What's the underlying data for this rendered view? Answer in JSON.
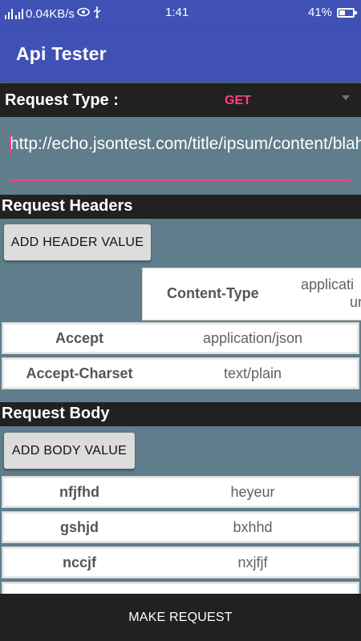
{
  "status_bar": {
    "network_speed": "0.04KB/s",
    "time": "1:41",
    "battery": "41%",
    "battery_level": 0.41,
    "icons": [
      "signal-icon",
      "sim-signal-icon",
      "eye-icon",
      "usb-icon",
      "battery-icon"
    ]
  },
  "app": {
    "title": "Api Tester",
    "accent_color": "#3f51b5",
    "highlight_color": "#ff4081"
  },
  "request_type": {
    "label": "Request Type :",
    "selected": "GET"
  },
  "url_input": {
    "value": "http://echo.jsontest.com/title/ipsum/content/blah"
  },
  "headers_section": {
    "title": "Request Headers",
    "add_button": "ADD HEADER VALUE",
    "rows": [
      {
        "key": "Content-Type",
        "value": "applicati",
        "value_line2": "ur"
      },
      {
        "key": "Accept",
        "value": "application/json"
      },
      {
        "key": "Accept-Charset",
        "value": "text/plain"
      }
    ]
  },
  "body_section": {
    "title": "Request Body",
    "add_button": "ADD BODY VALUE",
    "rows": [
      {
        "key": "nfjfhd",
        "value": "heyeur"
      },
      {
        "key": "gshjd",
        "value": "bxhhd"
      },
      {
        "key": "nccjf",
        "value": "nxjfjf"
      }
    ]
  },
  "footer": {
    "make_request": "MAKE REQUEST"
  }
}
